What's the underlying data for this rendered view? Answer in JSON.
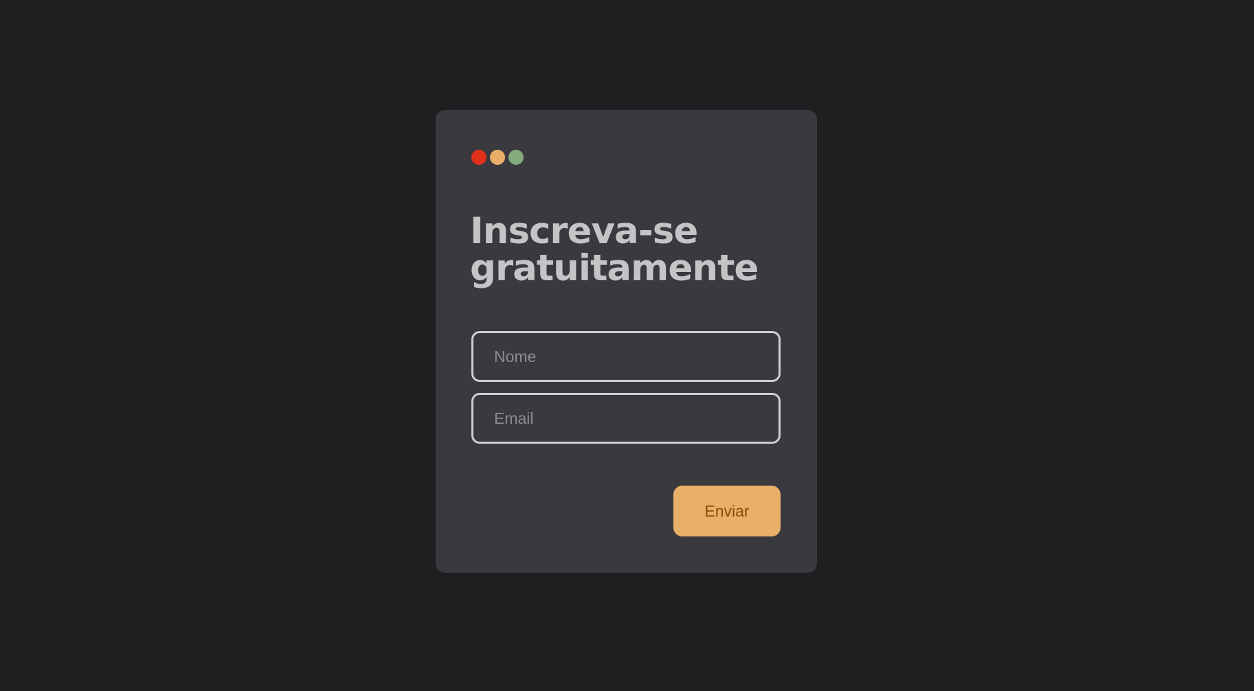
{
  "colors": {
    "background": "#1f1f21",
    "card": "#3a393e",
    "title": "#c4c4c6",
    "dot_red": "#e0311d",
    "dot_orange": "#e9af68",
    "dot_green": "#84ab7b",
    "button_bg": "#e9b067",
    "button_text": "#8a4a0c"
  },
  "window_controls": [
    "red-dot",
    "orange-dot",
    "green-dot"
  ],
  "form": {
    "title_line1": "Inscreva-se",
    "title_line2": "gratuitamente",
    "name_placeholder": "Nome",
    "name_value": "",
    "email_placeholder": "Email",
    "email_value": "",
    "submit_label": "Enviar"
  }
}
